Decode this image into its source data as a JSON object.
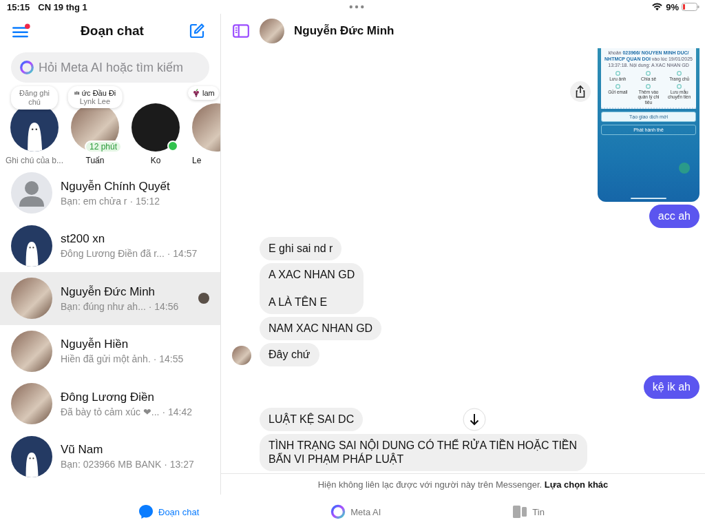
{
  "status_bar": {
    "time": "15:15",
    "date": "CN 19 thg 1",
    "battery": "9%"
  },
  "sidebar": {
    "title": "Đoạn chat",
    "menu_badge": true,
    "search": {
      "placeholder": "Hỏi Meta AI hoặc tìm kiếm"
    },
    "stories": [
      {
        "kind": "drawing",
        "note": {
          "kind": "plain",
          "text": "Đăng ghi chú"
        },
        "name": "Ghi chú của b...",
        "online": false
      },
      {
        "kind": "photo",
        "note": {
          "kind": "music",
          "text": "ức Đầu Đi",
          "sub": "Lynk Lee"
        },
        "name": "Tuấn",
        "badge": "12 phút",
        "online": false
      },
      {
        "kind": "dark",
        "name": "Ko",
        "online": true
      },
      {
        "kind": "photo",
        "note": {
          "kind": "grapes",
          "text": "lam"
        },
        "name": "Le",
        "online": false
      }
    ],
    "chats": [
      {
        "kind": "default",
        "name": "Nguyễn Chính Quyết",
        "preview": "Bạn: em chửa r · 15:12",
        "selected": false,
        "seen": false
      },
      {
        "kind": "drawing",
        "name": "st200 xn",
        "preview": "Đông Lương Điền đã r...  · 14:57",
        "selected": false,
        "seen": false
      },
      {
        "kind": "photo",
        "name": "Nguyễn Đức Minh",
        "preview": "Bạn: đúng như ah... · 14:56",
        "selected": true,
        "seen": true
      },
      {
        "kind": "photo",
        "name": "Nguyễn Hiền",
        "preview": "Hiền đã gửi một ảnh. · 14:55",
        "selected": false,
        "seen": false
      },
      {
        "kind": "photo",
        "name": "Đông Lương Điền",
        "preview": "Đã bày tỏ cảm xúc ❤... · 14:42",
        "selected": false,
        "seen": false
      },
      {
        "kind": "drawing",
        "name": "Vũ Nam",
        "preview": "Bạn: 023966 MB BANK · 13:27",
        "selected": false,
        "seen": false
      }
    ]
  },
  "conversation": {
    "name": "Nguyễn Đức Minh",
    "receipt": {
      "segments": [
        {
          "kind": "plain",
          "text": "khoản "
        },
        {
          "kind": "link",
          "text": "023966/ NGUYEN MINH DUC/ NHTMCP QUAN DOI"
        },
        {
          "kind": "plain",
          "text": " vào lúc 19/01/2025 13:37:18. Nội dung: A XAC NHAN GD"
        }
      ],
      "actions": [
        "Lưu ảnh",
        "Chia sẻ",
        "Trang chủ",
        "Gửi email",
        "Thêm vào quản lý chi tiêu",
        "Lưu mẫu chuyển tiền"
      ],
      "buttons": [
        "Tạo giao dịch mới",
        "Phát hành thẻ"
      ]
    },
    "messages": [
      {
        "kind": "image"
      },
      {
        "kind": "sent",
        "text": "acc ah"
      },
      {
        "kind": "received",
        "text": "E ghi sai nd r",
        "avatar": false
      },
      {
        "kind": "received",
        "text": "A XAC NHAN GD\n\nA LÀ TÊN E",
        "avatar": false
      },
      {
        "kind": "received",
        "text": "NAM XAC NHAN GD",
        "avatar": false
      },
      {
        "kind": "received",
        "text": "Đây chứ",
        "avatar": true
      },
      {
        "kind": "sent",
        "text": "kệ ik ah"
      },
      {
        "kind": "received",
        "text": "LUẬT KỆ SAI DC",
        "avatar": false
      },
      {
        "kind": "received",
        "text": "TÌNH TRẠNG SAI NỘI DUNG CÓ THỂ RỬA TIỀN HOẶC TIỀN BẨN VI PHẠM PHÁP LUẬT",
        "avatar": false
      }
    ],
    "notice": "Hiện không liên lạc được với người này trên Messenger.",
    "notice_link": "Lựa chọn khác"
  },
  "tabs": [
    {
      "label": "Đoạn chat",
      "selected": true
    },
    {
      "label": "Meta AI",
      "selected": false
    },
    {
      "label": "Tin",
      "selected": false
    }
  ]
}
